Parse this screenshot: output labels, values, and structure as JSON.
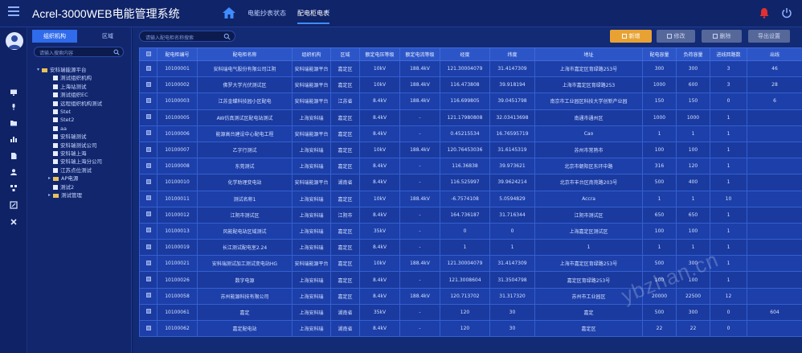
{
  "app": {
    "title": "Acrel-3000WEB电能管理系统"
  },
  "top_tabs": [
    {
      "label": "电能抄表状态"
    },
    {
      "label": "配电柜电表"
    }
  ],
  "left_rail": {
    "icons": [
      "monitor-icon",
      "microphone-icon",
      "folder-icon",
      "chart-icon",
      "document-icon",
      "user-icon",
      "network-icon",
      "edit-icon",
      "tool-icon"
    ]
  },
  "tree": {
    "tabs": {
      "active": "组织机构",
      "inactive": "区域"
    },
    "search_placeholder": "请输入搜索内容",
    "items": [
      {
        "label": "安科瑞能源平台",
        "level": 0,
        "type": "folder",
        "arrow": "▾"
      },
      {
        "label": "测试组织机构",
        "level": 1,
        "type": "doc",
        "arrow": ""
      },
      {
        "label": "上海站测试",
        "level": 1,
        "type": "doc",
        "arrow": ""
      },
      {
        "label": "测试组织EC",
        "level": 1,
        "type": "doc",
        "arrow": ""
      },
      {
        "label": "远程组织机构测试",
        "level": 1,
        "type": "doc",
        "arrow": ""
      },
      {
        "label": "Stet",
        "level": 1,
        "type": "doc",
        "arrow": ""
      },
      {
        "label": "Stet2",
        "level": 1,
        "type": "doc",
        "arrow": ""
      },
      {
        "label": "aa",
        "level": 1,
        "type": "doc",
        "arrow": ""
      },
      {
        "label": "安科瑞测试",
        "level": 1,
        "type": "doc",
        "arrow": ""
      },
      {
        "label": "安科瑞测试公司",
        "level": 1,
        "type": "doc",
        "arrow": ""
      },
      {
        "label": "安科瑞上海",
        "level": 1,
        "type": "doc",
        "arrow": ""
      },
      {
        "label": "安科瑞上海分公司",
        "level": 1,
        "type": "doc",
        "arrow": ""
      },
      {
        "label": "江苏点位测试",
        "level": 1,
        "type": "doc",
        "arrow": ""
      },
      {
        "label": "AP电源",
        "level": 1,
        "type": "folder",
        "arrow": "▸"
      },
      {
        "label": "测试2",
        "level": 1,
        "type": "doc",
        "arrow": ""
      },
      {
        "label": "测试管理",
        "level": 1,
        "type": "folder",
        "arrow": "▸"
      }
    ]
  },
  "toolbar": {
    "search_placeholder": "请输入配电柜名称搜索",
    "buttons": {
      "add": "新增",
      "b2": "修改",
      "b3": "删除",
      "b4": "导出设置"
    }
  },
  "table": {
    "columns": [
      "配电柜编号",
      "配电柜名称",
      "组织机构",
      "区域",
      "额定电压等级",
      "额定电流等级",
      "经度",
      "纬度",
      "地址",
      "配电容量",
      "负荷容量",
      "进线回路数",
      "出线"
    ],
    "rows": [
      [
        "10100001",
        "安科瑞电气股份有限公司江阴",
        "安科瑞能源平台",
        "嘉定区",
        "10kV",
        "188.4kV",
        "121.30004079",
        "31.4147309",
        "上海市嘉定区育绿路253号",
        "300",
        "300",
        "3",
        "46"
      ],
      [
        "10100002",
        "佛罗大学光伏测试区",
        "安科瑞能源平台",
        "嘉定区",
        "10kV",
        "188.4kV",
        "116.473808",
        "39.918194",
        "上海市嘉定区育绿路253",
        "1000",
        "600",
        "3",
        "28"
      ],
      [
        "10100003",
        "江苏金蝶科技园小区配电",
        "安科瑞能源平台",
        "江苏省",
        "8.4kV",
        "188.4kV",
        "116.699805",
        "39.0451798",
        "南京市工业园区科技大学创新产业园",
        "150",
        "150",
        "0",
        "6"
      ],
      [
        "10100005",
        "AW仿真测试区配电站测试",
        "上海安科瑞",
        "嘉定区",
        "8.4kV",
        "-",
        "121.17980808",
        "32.03413698",
        "南通市通州区",
        "1000",
        "1000",
        "1",
        ""
      ],
      [
        "10100006",
        "能源高台建设中心配电工程",
        "安科瑞能源平台",
        "嘉定区",
        "8.4kV",
        "-",
        "0.45215534",
        "16.76595719",
        "Cao",
        "1",
        "1",
        "1",
        ""
      ],
      [
        "10100007",
        "乙字行测试",
        "上海安科瑞",
        "嘉定区",
        "10kV",
        "188.4kV",
        "120.76453036",
        "31.6145319",
        "苏州市常熟市",
        "100",
        "100",
        "1",
        ""
      ],
      [
        "10100008",
        "东莞测试",
        "上海安科瑞",
        "嘉定区",
        "8.4kV",
        "-",
        "116.36838",
        "39.973621",
        "北京市朝阳区东环中路",
        "316",
        "120",
        "1",
        ""
      ],
      [
        "10100010",
        "化学助理变电站",
        "安科瑞能源平台",
        "湖南省",
        "8.4kV",
        "-",
        "116.525997",
        "39.9624214",
        "北京市丰台区南苑路203号",
        "500",
        "400",
        "1",
        ""
      ],
      [
        "10100011",
        "测试名称1",
        "上海安科瑞",
        "嘉定区",
        "10kV",
        "188.4kV",
        "-6.7574108",
        "5.0594829",
        "Accra",
        "1",
        "1",
        "10",
        ""
      ],
      [
        "10100012",
        "江阴市测试区",
        "上海安科瑞",
        "江阴市",
        "8.4kV",
        "-",
        "164.736187",
        "31.716344",
        "江阴市测试区",
        "650",
        "650",
        "1",
        ""
      ],
      [
        "10100013",
        "风能配电站区域测试",
        "上海安科瑞",
        "嘉定区",
        "35kV",
        "-",
        "0",
        "0",
        "上海嘉定区测试区",
        "100",
        "100",
        "1",
        ""
      ],
      [
        "10100019",
        "长江测试配电室2.24",
        "上海安科瑞",
        "嘉定区",
        "8.4kV",
        "-",
        "1",
        "1",
        "1",
        "1",
        "1",
        "1",
        ""
      ],
      [
        "10100021",
        "安科瑞测试加工测试变电站HG",
        "安科瑞能源平台",
        "嘉定区",
        "10kV",
        "188.4kV",
        "121.30004079",
        "31.4147309",
        "上海市嘉定区育绿路253号",
        "500",
        "300",
        "1",
        ""
      ],
      [
        "10100026",
        "数字电源",
        "上海安科瑞",
        "嘉定区",
        "8.4kV",
        "-",
        "121.3008604",
        "31.3504798",
        "嘉定区育绿路253号",
        "100",
        "100",
        "1",
        ""
      ],
      [
        "10100058",
        "苏州能源科技有限公司",
        "上海安科瑞",
        "嘉定区",
        "8.4kV",
        "188.4kV",
        "120.713702",
        "31.317320",
        "苏州市工业园区",
        "20000",
        "22500",
        "12",
        ""
      ],
      [
        "10100061",
        "嘉定",
        "上海安科瑞",
        "湖南省",
        "35kV",
        "-",
        "120",
        "30",
        "嘉定",
        "500",
        "300",
        "0",
        "604"
      ],
      [
        "10100062",
        "嘉定配电站",
        "上海安科瑞",
        "湖南省",
        "8.4kV",
        "-",
        "120",
        "30",
        "嘉定区",
        "22",
        "22",
        "0",
        ""
      ]
    ]
  },
  "watermark": "ybzhan.cn"
}
